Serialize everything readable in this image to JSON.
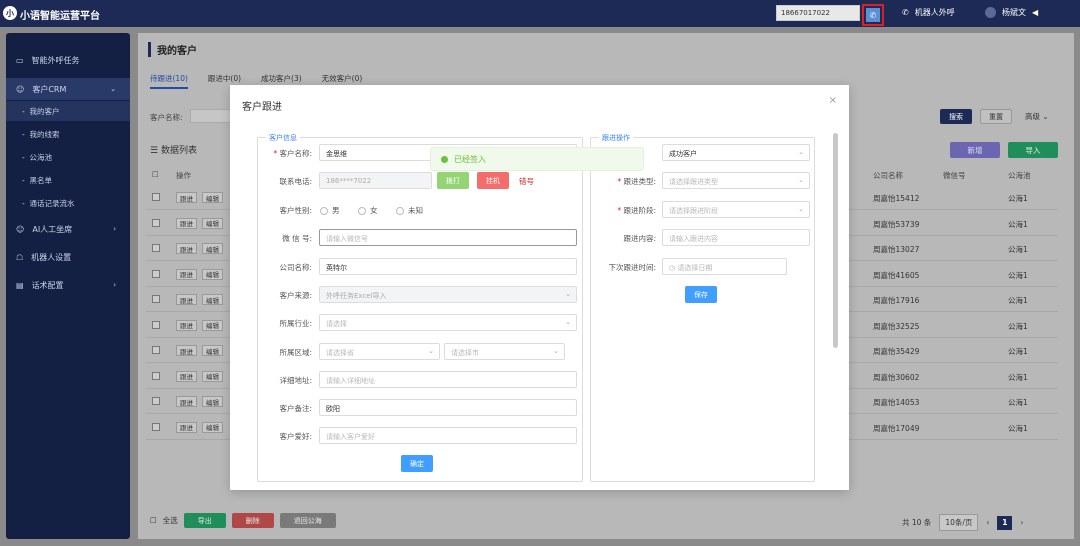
{
  "topbar": {
    "logo_glyph": "小",
    "app_title": "小语智能运营平台",
    "phone_number": "18667017022",
    "robot_call": "机器人外呼",
    "user_name": "杨斌文",
    "call_icon": "phone-icon"
  },
  "sidebar": {
    "items": [
      {
        "label": "智能外呼任务"
      },
      {
        "label": "客户CRM"
      },
      {
        "label": "AI人工坐席"
      },
      {
        "label": "机器人设置"
      },
      {
        "label": "话术配置"
      }
    ],
    "sub_items": [
      {
        "label": "我的客户"
      },
      {
        "label": "我的线索"
      },
      {
        "label": "公海池"
      },
      {
        "label": "黑名单"
      },
      {
        "label": "通话记录流水"
      }
    ]
  },
  "content": {
    "title": "我的客户",
    "tabs": [
      "待跟进(10)",
      "跟进中(0)",
      "成功客户(3)",
      "无效客户(0)"
    ],
    "filter_label": "客户名称:",
    "filter_placeholder": "请输入客户名称",
    "search_btn": "搜索",
    "reset_btn": "重置",
    "advanced": "高级",
    "list_title": "数据列表",
    "new_btn": "新增",
    "import_btn": "导入",
    "col_action": "操作",
    "col_company": "公司名称",
    "col_wechat": "微信号",
    "col_pool": "公海池",
    "row_btn_follow": "跟进",
    "row_btn_edit": "编辑",
    "rows": [
      {
        "company": "周嘉怡15412",
        "pool": "公海1"
      },
      {
        "company": "周嘉怡53739",
        "pool": "公海1"
      },
      {
        "company": "周嘉怡13027",
        "pool": "公海1"
      },
      {
        "company": "周嘉怡41605",
        "pool": "公海1"
      },
      {
        "company": "周嘉怡17916",
        "pool": "公海1"
      },
      {
        "company": "周嘉怡32525",
        "pool": "公海1"
      },
      {
        "company": "周嘉怡35429",
        "pool": "公海1"
      },
      {
        "company": "周嘉怡30602",
        "pool": "公海1"
      },
      {
        "company": "周嘉怡14053",
        "pool": "公海1"
      },
      {
        "company": "周嘉怡17049",
        "pool": "公海1"
      }
    ],
    "select_all": "全选",
    "export_btn": "导出",
    "delete_btn": "删除",
    "return_pool_btn": "退回公海",
    "total": "共 10 条",
    "page_size": "10条/页",
    "current_page": "1"
  },
  "modal": {
    "title": "客户跟进",
    "close": "×",
    "toast": "已经签入",
    "customer_info_legend": "客户信息",
    "follow_op_legend": "跟进操作",
    "fields": {
      "name_label": "客户名称:",
      "name_value": "金思维",
      "phone_label": "联系电话:",
      "phone_value": "186****7022",
      "dial_btn": "拨打",
      "hangup_btn": "挂机",
      "wrong_number": "错号",
      "gender_label": "客户性别:",
      "gender_male": "男",
      "gender_female": "女",
      "gender_unknown": "未知",
      "wechat_label": "微 信 号:",
      "wechat_placeholder": "请输入微信号",
      "company_label": "公司名称:",
      "company_value": "英特尔",
      "source_label": "客户来源:",
      "source_value": "外呼任务Excel导入",
      "industry_label": "所属行业:",
      "industry_placeholder": "请选择",
      "region_label": "所属区域:",
      "province_placeholder": "请选择省",
      "city_placeholder": "请选择市",
      "address_label": "详细地址:",
      "address_placeholder": "请输入详细地址",
      "remark_label": "客户备注:",
      "remark_value": "欧阳",
      "hobby_label": "客户爱好:",
      "hobby_placeholder": "请输入客户爱好",
      "confirm_btn": "确定"
    },
    "follow": {
      "status_value": "成功客户",
      "type_label": "跟进类型:",
      "type_placeholder": "请选择跟进类型",
      "stage_label": "跟进阶段:",
      "stage_placeholder": "请选择跟进阶段",
      "content_label": "跟进内容:",
      "content_placeholder": "请输入跟进内容",
      "next_time_label": "下次跟进时间:",
      "next_time_placeholder": "请选择日期",
      "save_btn": "保存"
    }
  }
}
